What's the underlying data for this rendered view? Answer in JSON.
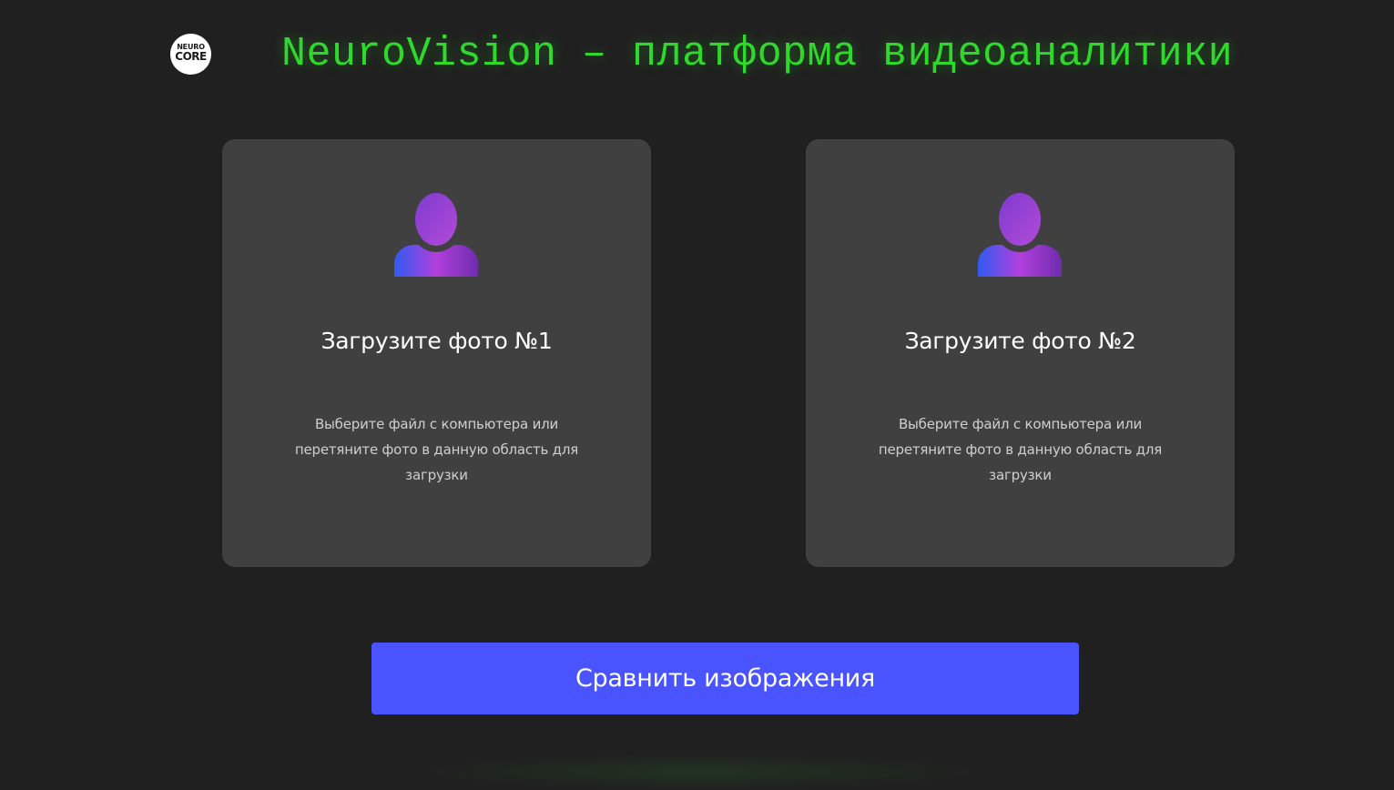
{
  "header": {
    "logo_line1": "NEURO",
    "logo_line2": "CORE",
    "title": "NeuroVision – платформа видеоаналитики"
  },
  "upload_cards": [
    {
      "icon": "user-avatar-icon",
      "title": "Загрузите фото №1",
      "description": "Выберите файл с компьютера или перетяните фото в данную область для загрузки"
    },
    {
      "icon": "user-avatar-icon",
      "title": "Загрузите фото №2",
      "description": "Выберите файл с компьютера или перетяните фото в данную область для загрузки"
    }
  ],
  "compare_button": {
    "label": "Сравнить изображения"
  },
  "colors": {
    "background": "#202020",
    "card_background": "#404040",
    "title_green": "#2fd92c",
    "button_blue": "#4954ff",
    "avatar_gradient_start": "#3b5cf0",
    "avatar_gradient_mid": "#b03ee0",
    "avatar_gradient_end": "#7a2fbf"
  }
}
